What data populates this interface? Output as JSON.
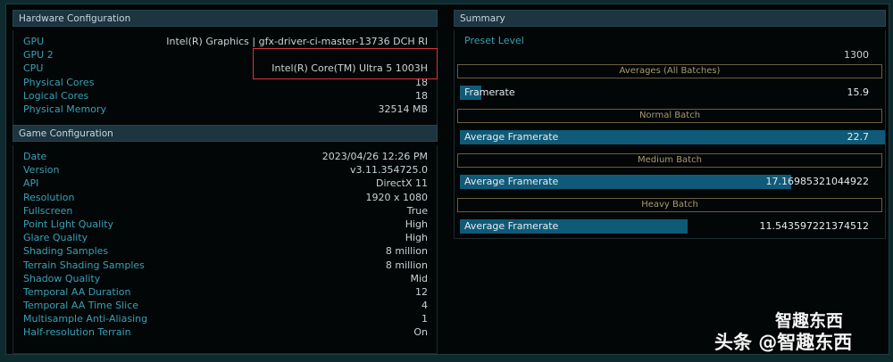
{
  "hardware": {
    "title": "Hardware Configuration",
    "rows": [
      {
        "k": "GPU",
        "v": "Intel(R) Graphics | gfx-driver-ci-master-13736 DCH RI"
      },
      {
        "k": "GPU 2",
        "v": ""
      },
      {
        "k": "CPU",
        "v": "Intel(R) Core(TM) Ultra 5 1003H"
      },
      {
        "k": "Physical Cores",
        "v": "18"
      },
      {
        "k": "Logical Cores",
        "v": "18"
      },
      {
        "k": "Physical Memory",
        "v": "32514 MB"
      }
    ]
  },
  "game": {
    "title": "Game Configuration",
    "rows": [
      {
        "k": "Date",
        "v": "2023/04/26 12:26 PM"
      },
      {
        "k": "Version",
        "v": "v3.11.354725.0"
      },
      {
        "k": "API",
        "v": "DirectX 11"
      },
      {
        "k": "Resolution",
        "v": "1920 x 1080"
      },
      {
        "k": "Fullscreen",
        "v": "True"
      },
      {
        "k": "Point Light Quality",
        "v": "High"
      },
      {
        "k": "Glare Quality",
        "v": "High"
      },
      {
        "k": "Shading Samples",
        "v": "8 million"
      },
      {
        "k": "Terrain Shading Samples",
        "v": "8 million"
      },
      {
        "k": "Shadow Quality",
        "v": "Mid"
      },
      {
        "k": "Temporal AA Duration",
        "v": "12"
      },
      {
        "k": "Temporal AA Time Slice",
        "v": "4"
      },
      {
        "k": "Multisample Anti-Aliasing",
        "v": "1"
      },
      {
        "k": "Half-resolution Terrain",
        "v": "On"
      }
    ]
  },
  "summary": {
    "title": "Summary",
    "preset_label": "Preset Level",
    "preset_value": "1300",
    "sections": [
      {
        "title": "Averages (All Batches)",
        "label": "Framerate",
        "value": "15.9",
        "fill": 0.05
      },
      {
        "title": "Normal Batch",
        "label": "Average Framerate",
        "value": "22.7",
        "fill": 1.0
      },
      {
        "title": "Medium Batch",
        "label": "Average Framerate",
        "value": "17.16985321044922",
        "fill": 0.78
      },
      {
        "title": "Heavy Batch",
        "label": "Average Framerate",
        "value": "11.543597221374512",
        "fill": 0.535
      }
    ]
  },
  "watermark": {
    "line1": "智趣东西",
    "line2": "头条 @智趣东西"
  }
}
